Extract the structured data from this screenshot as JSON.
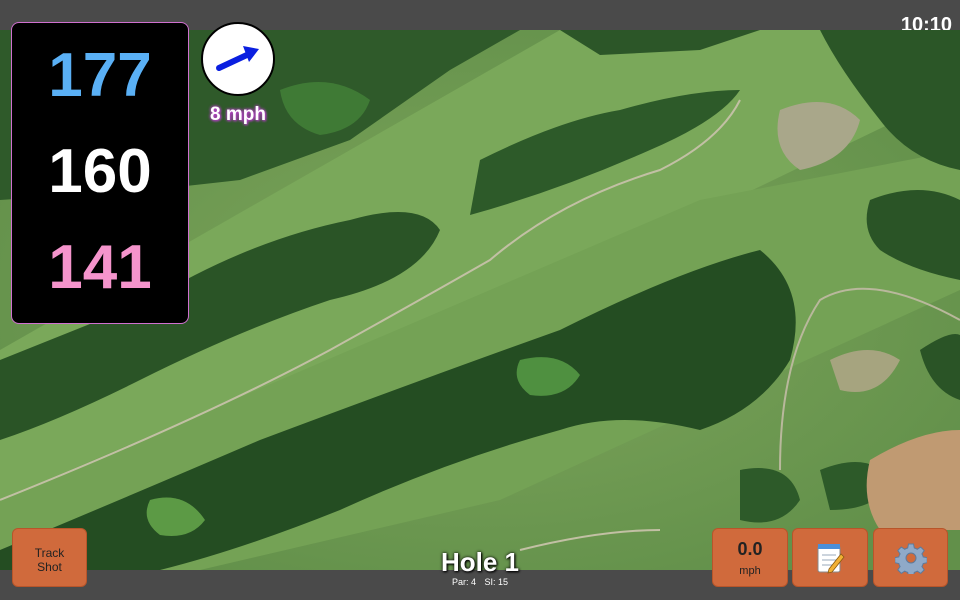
{
  "status_bar": {
    "time": "10:10"
  },
  "distances": {
    "back": "177",
    "center": "160",
    "front": "141"
  },
  "wind": {
    "speed_label": "8 mph",
    "direction_icon": "wind-arrow-icon",
    "arrow_color": "#0a1fe0"
  },
  "buttons": {
    "track_shot_line1": "Track",
    "track_shot_line2": "Shot",
    "speed_value": "0.0",
    "speed_unit": "mph",
    "notes_icon": "notepad-icon",
    "settings_icon": "gear-icon"
  },
  "hole": {
    "title": "Hole 1",
    "par": "Par: 4",
    "si": "SI: 15"
  },
  "colors": {
    "back_distance": "#5ab0f5",
    "center_distance": "#ffffff",
    "front_distance": "#f594cc",
    "button": "#d06a3c",
    "panel_border": "#d070d0"
  }
}
